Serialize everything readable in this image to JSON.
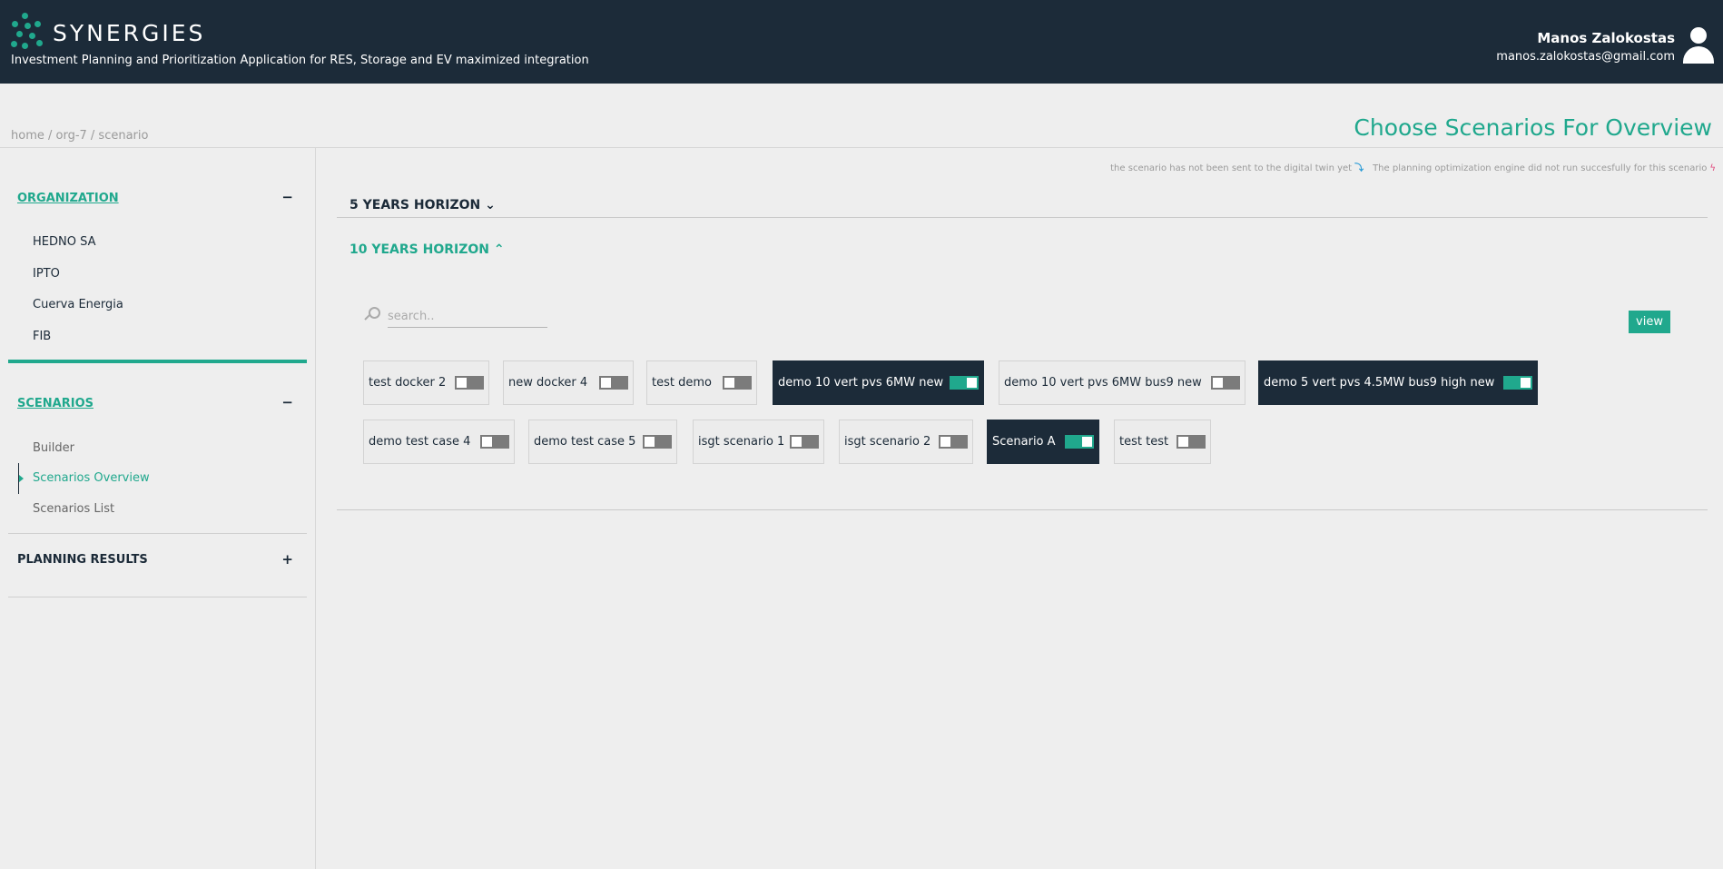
{
  "header": {
    "brand": "SYNERGIES",
    "tagline": "Investment Planning and Prioritization Application for RES, Storage and EV maximized integration",
    "user_name": "Manos Zalokostas",
    "user_email": "manos.zalokostas@gmail.com"
  },
  "breadcrumb": "home / org-7 / scenario",
  "page_title": "Choose Scenarios For Overview",
  "colors": {
    "accent": "#20a88d",
    "navy": "#1c2b39"
  },
  "sidebar": {
    "organization": {
      "label": "ORGANIZATION",
      "toggle": "−",
      "items": [
        "HEDNO SA",
        "IPTO",
        "Cuerva Energia",
        "FIB"
      ]
    },
    "scenarios": {
      "label": "SCENARIOS",
      "toggle": "−",
      "items": [
        "Builder",
        "Scenarios Overview",
        "Scenarios List"
      ],
      "current": "Scenarios Overview"
    },
    "planning_results": {
      "label": "PLANNING RESULTS",
      "toggle": "+"
    }
  },
  "legend": {
    "not_sent": "the scenario has not been sent to the digital twin yet",
    "not_sent_icon": "down-arrow-icon",
    "engine_failed": "The planning optimization engine did not run succesfully for this scenario",
    "engine_failed_icon": "lightning-bolt-icon"
  },
  "horizons": {
    "five_years": "5 YEARS HORIZON",
    "ten_years": "10 YEARS HORIZON"
  },
  "search": {
    "placeholder": "search.."
  },
  "view_button": "view",
  "scenarios": [
    {
      "label": "test docker 2",
      "selected": false
    },
    {
      "label": "new docker 4",
      "selected": false
    },
    {
      "label": "test demo",
      "selected": false
    },
    {
      "label": "demo 10 vert pvs 6MW new",
      "selected": true
    },
    {
      "label": "demo 10 vert pvs 6MW bus9 new",
      "selected": false
    },
    {
      "label": "demo 5 vert pvs 4.5MW bus9 high new",
      "selected": true
    },
    {
      "label": "demo test case 4",
      "selected": false
    },
    {
      "label": "demo test case 5",
      "selected": false
    },
    {
      "label": "isgt scenario 1",
      "selected": false
    },
    {
      "label": "isgt scenario 2",
      "selected": false
    },
    {
      "label": "Scenario A",
      "selected": true
    },
    {
      "label": "test test",
      "selected": false
    }
  ]
}
